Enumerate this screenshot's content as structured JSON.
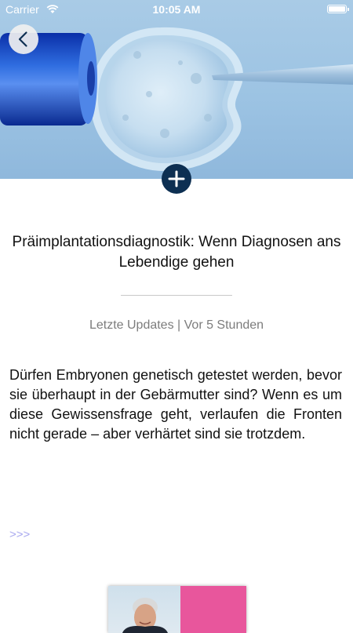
{
  "status_bar": {
    "carrier": "Carrier",
    "time": "10:05 AM",
    "battery_level": 1.0
  },
  "header": {
    "back_icon": "chevron-left-icon",
    "add_icon": "plus-icon",
    "add_button_color": "#0d2f52"
  },
  "article": {
    "title": "Präimplantationsdiagnostik: Wenn Diagnosen ans Lebendige gehen",
    "meta": "Letzte Updates | Vor 5 Stunden",
    "body": "Dürfen Embryonen genetisch getestet werden, bevor sie überhaupt in der Gebärmutter sind? Wenn es um diese Gewissensfrage geht, verlaufen die Fronten nicht gerade – aber verhärtet sind sie trotzdem.",
    "more_link": ">>>"
  },
  "colors": {
    "meta_text": "#7c7c7c",
    "more_link": "#a9a9ef",
    "teaser_accent": "#e8569c"
  }
}
